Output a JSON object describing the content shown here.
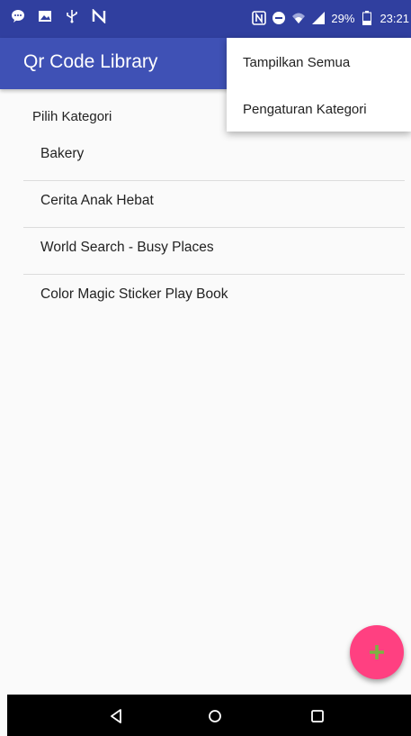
{
  "status_bar": {
    "battery": "29%",
    "time": "23:21",
    "left_icons": [
      "chat-icon",
      "image-icon",
      "usb-icon",
      "n-icon"
    ],
    "right_icons": [
      "nfc-icon",
      "dnd-icon",
      "wifi-icon",
      "signal-icon",
      "battery-icon"
    ]
  },
  "app_bar": {
    "title": "Qr Code Library",
    "color": "#3f51b5"
  },
  "section": {
    "label": "Pilih Kategori"
  },
  "list": {
    "items": [
      "Bakery",
      "Cerita Anak Hebat",
      "World Search - Busy Places",
      "Color Magic Sticker Play Book"
    ]
  },
  "menu": {
    "items": [
      "Tampilkan Semua",
      "Pengaturan Kategori"
    ]
  },
  "fab": {
    "icon": "plus-icon",
    "color": "#ff4081"
  },
  "nav_bar": {
    "icons": [
      "back-icon",
      "home-icon",
      "recents-icon"
    ]
  }
}
